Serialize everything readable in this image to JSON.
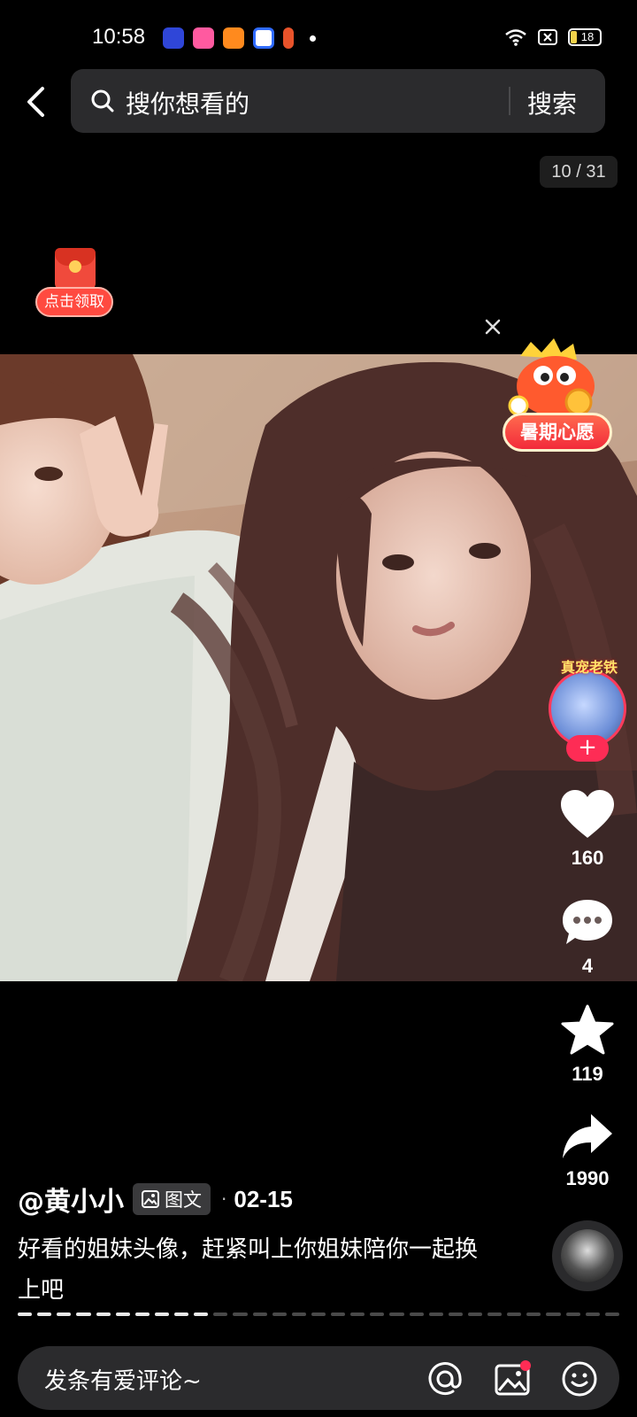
{
  "status_bar": {
    "time": "10:58",
    "battery": "18",
    "app_icons": [
      {
        "name": "theme-app-icon",
        "color": "#2f46d8"
      },
      {
        "name": "vivid-app-icon",
        "color": "#ff5aa0"
      },
      {
        "name": "game-app-icon",
        "color": "#ff8a1e"
      },
      {
        "name": "baidu-app-icon",
        "color": "#2f6bff"
      },
      {
        "name": "office-app-icon",
        "color": "#e8532a"
      }
    ]
  },
  "search": {
    "placeholder": "搜你想看的",
    "button": "搜索"
  },
  "counter": "10 / 31",
  "red_packet": {
    "label": "点击领取"
  },
  "promo": {
    "label": "暑期心愿"
  },
  "avatar": {
    "tag": "真宠老铁"
  },
  "actions": {
    "likes": "160",
    "comments": "4",
    "favorites": "119",
    "shares": "1990"
  },
  "post": {
    "author": "@黄小小",
    "tag": "图文",
    "date": "02-15",
    "caption": "好看的姐妹头像，赶紧叫上你姐妹陪你一起换上吧"
  },
  "progress": {
    "current": 10,
    "total": 31
  },
  "comment": {
    "placeholder": "发条有爱评论~"
  },
  "colors": {
    "accent": "#fe2c55",
    "bar_bg": "#2b2b2d"
  }
}
